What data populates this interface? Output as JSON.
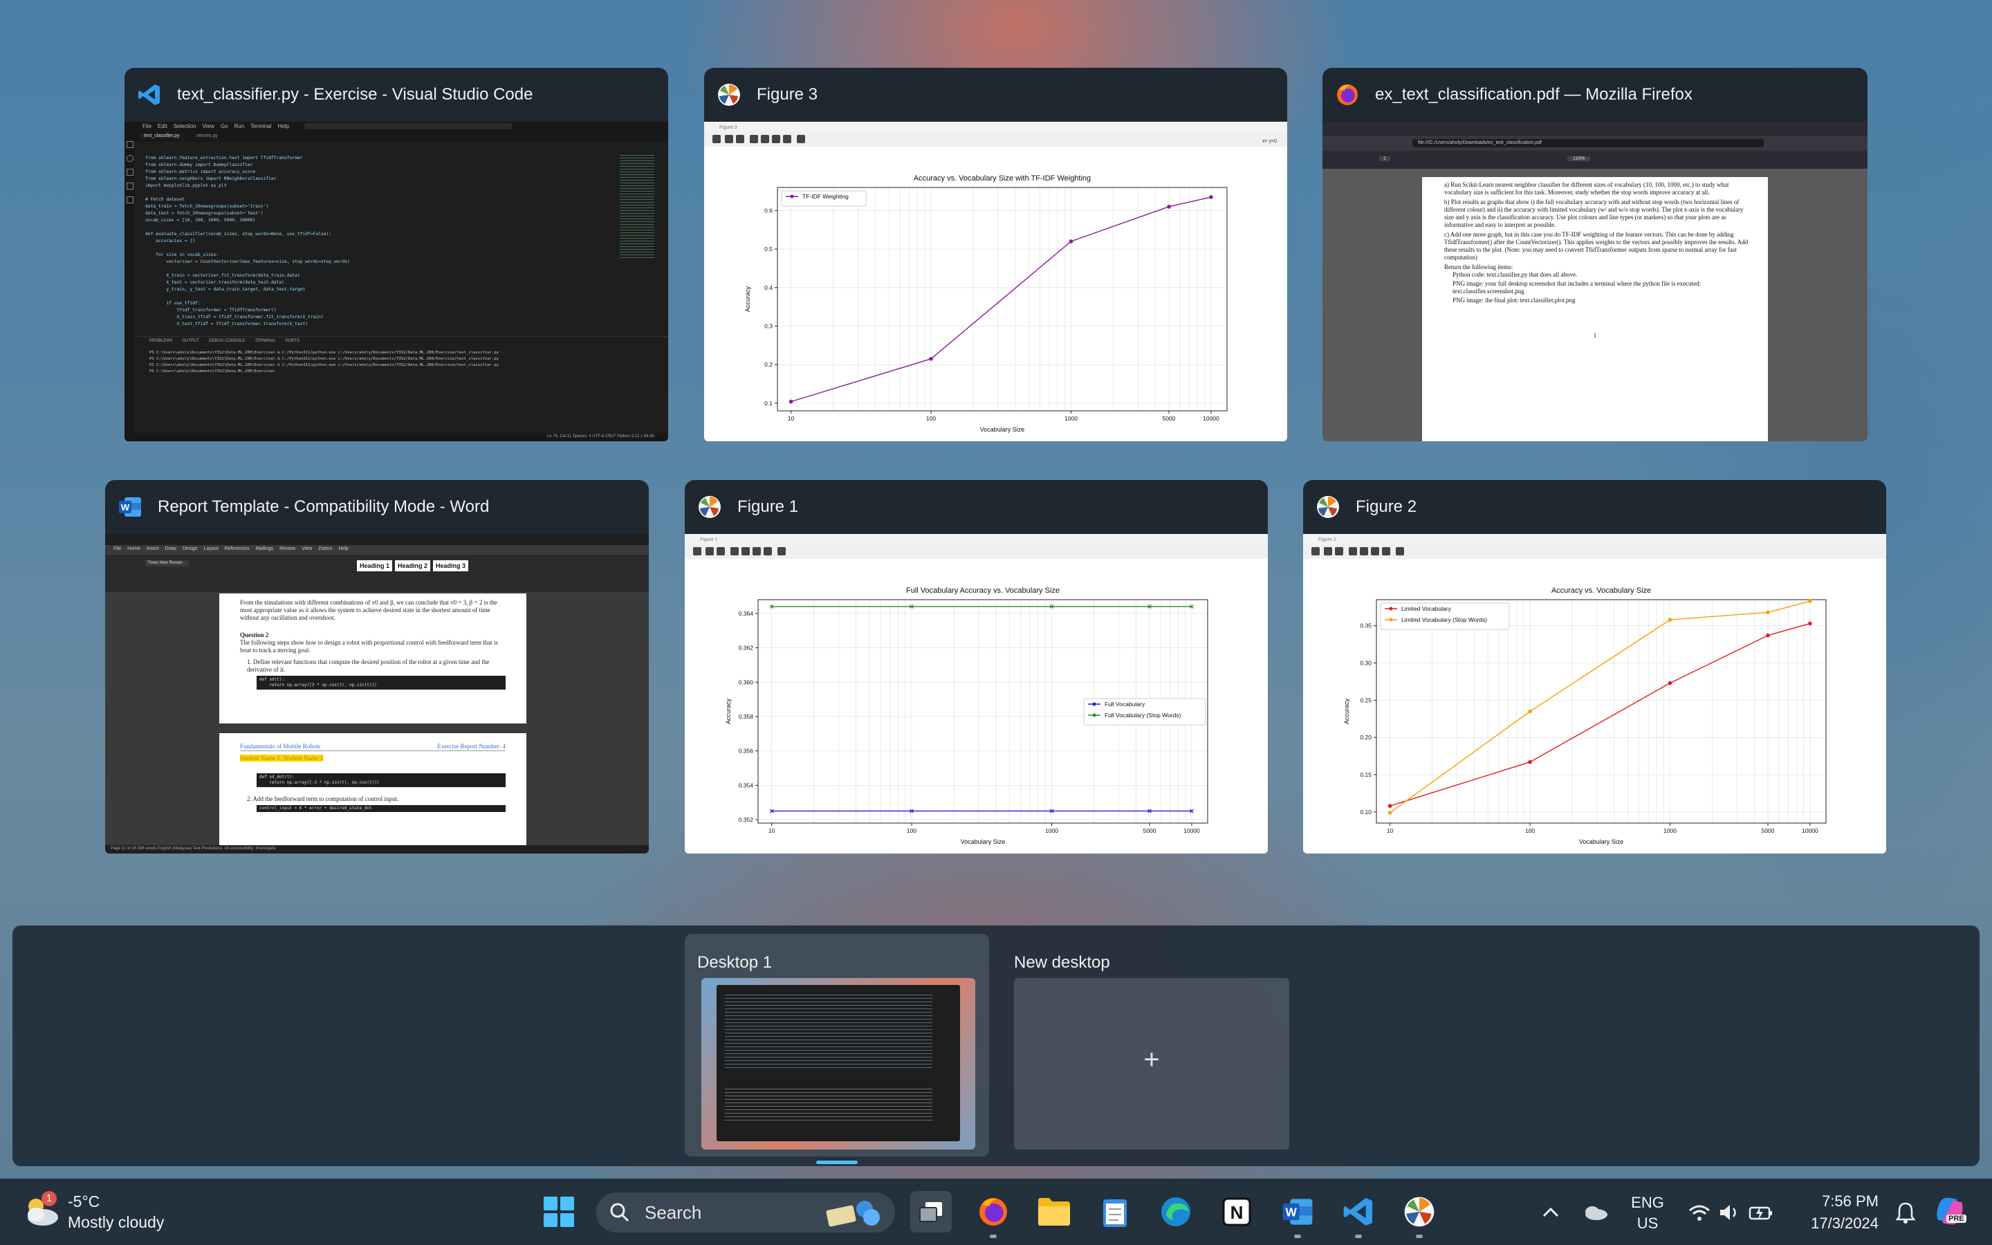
{
  "windows": {
    "vscode": {
      "title": "text_classifier.py - Exercise - Visual Studio Code",
      "menu": [
        "File",
        "Edit",
        "Selection",
        "View",
        "Go",
        "Run",
        "Terminal",
        "Help"
      ],
      "tab": "text_classifier.py",
      "tab2": "reinres.py",
      "code": [
        "from sklearn.feature_extraction.text import TfidfTransformer",
        "from sklearn.dummy import DummyClassifier",
        "from sklearn.metrics import accuracy_score",
        "from sklearn.neighbors import KNeighborsClassifier",
        "import matplotlib.pyplot as plt",
        "",
        "# Fetch dataset",
        "data_train = fetch_20newsgroups(subset='train')",
        "data_test = fetch_20newsgroups(subset='test')",
        "vocab_sizes = [10, 100, 1000, 5000, 10000]",
        "",
        "def evaluate_classifier(vocab_sizes, stop_words=None, use_tfidf=False):",
        "    accuracies = []",
        "",
        "    for size in vocab_sizes:",
        "        vectorizer = CountVectorizer(max_features=size, stop_words=stop_words)",
        "",
        "        X_train = vectorizer.fit_transform(data_train.data)",
        "        X_test = vectorizer.transform(data_test.data)",
        "        y_train, y_test = data_train.target, data_test.target",
        "",
        "        if use_tfidf:",
        "            tfidf_transformer = TfidfTransformer()",
        "            X_train_tfidf = tfidf_transformer.fit_transform(X_train)",
        "            X_test_tfidf = tfidf_transformer.transform(X_test)"
      ],
      "panel_tabs": [
        "PROBLEMS",
        "OUTPUT",
        "DEBUG CONSOLE",
        "TERMINAL",
        "PORTS"
      ],
      "terminal": [
        "PS C:\\Users\\aholy\\Documents\\Y3S2\\Data.ML.200\\Exercise> & C:/Python311/python.exe c:/Users/aholy/Documents/Y3S2/Data.ML.200/Exercise/text_classifier.py",
        "PS C:\\Users\\aholy\\Documents\\Y3S2\\Data.ML.200\\Exercise> & C:/Python311/python.exe c:/Users/aholy/Documents/Y3S2/Data.ML.200/Exercise/text_classifier.py",
        "PS C:\\Users\\aholy\\Documents\\Y3S2\\Data.ML.200\\Exercise> & C:/Python311/python.exe c:/Users/aholy/Documents/Y3S2/Data.ML.200/Exercise/text_classifier.py",
        "PS C:\\Users\\aholy\\Documents\\Y3S2\\Data.ML.200\\Exercise>"
      ],
      "status": "Ln 78, Col 11   Spaces: 4   UTF-8   CRLF   Python   3.12.1 64-bit"
    },
    "figure3": {
      "title": "Figure 3",
      "inner_title": "Figure 3",
      "coord": "x= y=0."
    },
    "firefox": {
      "title": "ex_text_classification.pdf — Mozilla Firefox",
      "url": "file:///C:/Users/aholy/Downloads/ex_text_classification.pdf",
      "page_number": "1",
      "zoom": "110%",
      "items": [
        "a) Run Scikit-Learn nearest neighbor classifier for different sizes of vocabulary (10, 100, 1000, etc.) to study what vocabulary size is sufficient for this task. Moreover, study whether the stop words improve accuracy at all.",
        "b) Plot results as graphs that show i) the full vocabulary accuracy with and without stop words (two horizontal lines of different colour) and ii) the accuracy with limited vocabulary (w/ and w/o stop words). The plot x-axis is the vocabulary size and y axis is the classification accuracy. Use plot colours and line types (or markers) so that your plots are as informative and easy to interpret as possible.",
        "c) Add one more graph, but in this case you do TF-IDF weighting of the feature vectors. This can be done by adding TfidfTransformer() after the CountVectorizer(). This applies weights to the vectors and possibly improves the results. Add these results to the plot. (Note: you may need to convert TfidTransformer outputs from sparse to normal array for fast computation)"
      ],
      "return_label": "Return the following items:",
      "bullets": [
        "Python code: text.classifier.py that does all above.",
        "PNG image: your full desktop screenshot that includes a terminal where the python file is executed: text.classifier.screenshot.png",
        "PNG image: the final plot: text.classifier.plot.png"
      ]
    },
    "word": {
      "title": "Report Template  -  Compatibility Mode - Word",
      "ribbon_tabs": [
        "File",
        "Home",
        "Insert",
        "Draw",
        "Design",
        "Layout",
        "References",
        "Mailings",
        "Review",
        "View",
        "Zotero",
        "Help"
      ],
      "styles": [
        "Heading 1",
        "Heading 2",
        "Heading 3"
      ],
      "font": "Times New Roman",
      "para1": "From the simulations with different combinations of v0 and β, we can conclude that v0 = 3, β = 2 is the most appropriate value as it allows the system to achieve desired state in the shortest amount of time without any oscillation and overshoot.",
      "q2_heading": "Question 2",
      "q2_text": "The following steps show how to design a robot with proportional control with feedforward term that is bout to track a moving goal.",
      "step1": "1.   Define relevant functions that compute the desired position of the robot at a given time and the derivative of it.",
      "code1": [
        "def xd(t):",
        "    return np.array([3 * np.cos(t), np.sin(t)])"
      ],
      "header_left": "Fundamentals of Mobile Robots",
      "header_right": "Exercise Report Number: 4",
      "student": "Student Name 1, Student Name 2",
      "code2": [
        "def xd_dot(t):",
        "    return np.array([-3 * np.sin(t), np.cos(t)])"
      ],
      "step2": "2.   Add the feedforward term to computation of control input.",
      "code3": "control_input = K * error + desired_state_dot",
      "status": "Page 11 of 16   336 words   English (Malaysia)   Text Predictions: On   Accessibility: Investigate"
    },
    "figure1": {
      "title": "Figure 1",
      "inner_title": "Figure 1"
    },
    "figure2": {
      "title": "Figure 2",
      "inner_title": "Figure 2"
    }
  },
  "chart_data": [
    {
      "id": "figure3",
      "type": "line",
      "title": "Accuracy vs. Vocabulary Size with TF-IDF Weighting",
      "xlabel": "Vocabulary Size",
      "ylabel": "Accuracy",
      "x_scale": "log",
      "x": [
        10,
        100,
        1000,
        5000,
        10000
      ],
      "xticks": [
        "10",
        "100",
        "1000",
        "5000",
        "10000"
      ],
      "ylim": [
        0.08,
        0.66
      ],
      "yticks": [
        "0.1",
        "0.2",
        "0.3",
        "0.4",
        "0.5",
        "0.6"
      ],
      "grid": true,
      "legend_position": "upper left",
      "series": [
        {
          "name": "TF-IDF Weighting",
          "color": "#8b1a9a",
          "values": [
            0.104,
            0.215,
            0.52,
            0.61,
            0.635
          ]
        }
      ]
    },
    {
      "id": "figure1",
      "type": "line",
      "title": "Full Vocabulary Accuracy vs. Vocabulary Size",
      "xlabel": "Vocabulary Size",
      "ylabel": "Accuracy",
      "x_scale": "log",
      "x": [
        10,
        100,
        1000,
        5000,
        10000
      ],
      "xticks": [
        "10",
        "100",
        "1000",
        "5000",
        "10000"
      ],
      "ylim": [
        0.3518,
        0.3648
      ],
      "yticks": [
        "0.352",
        "0.354",
        "0.356",
        "0.358",
        "0.360",
        "0.362",
        "0.364"
      ],
      "grid": true,
      "legend_position": "center right",
      "series": [
        {
          "name": "Full Vocabulary",
          "color": "#1f1fd6",
          "values": [
            0.3525,
            0.3525,
            0.3525,
            0.3525,
            0.3525
          ]
        },
        {
          "name": "Full Vocabulary (Stop Words)",
          "color": "#2a8a2a",
          "values": [
            0.3644,
            0.3644,
            0.3644,
            0.3644,
            0.3644
          ]
        }
      ]
    },
    {
      "id": "figure2",
      "type": "line",
      "title": "Accuracy vs. Vocabulary Size",
      "xlabel": "Vocabulary Size",
      "ylabel": "Accuracy",
      "x_scale": "log",
      "x": [
        10,
        100,
        1000,
        5000,
        10000
      ],
      "xticks": [
        "10",
        "100",
        "1000",
        "5000",
        "10000"
      ],
      "ylim": [
        0.085,
        0.385
      ],
      "yticks": [
        "0.10",
        "0.15",
        "0.20",
        "0.25",
        "0.30",
        "0.35"
      ],
      "grid": true,
      "legend_position": "upper left",
      "series": [
        {
          "name": "Limited Vocabulary",
          "color": "#e8191b",
          "values": [
            0.108,
            0.167,
            0.273,
            0.337,
            0.353
          ]
        },
        {
          "name": "Limited Vocabulary (Stop Words)",
          "color": "#f5a300",
          "values": [
            0.099,
            0.235,
            0.358,
            0.368,
            0.383
          ]
        }
      ]
    }
  ],
  "desktops": {
    "desktop1_label": "Desktop 1",
    "new_label": "New desktop",
    "plus": "+"
  },
  "taskbar": {
    "weather_badge": "1",
    "temperature": "-5°C",
    "condition": "Mostly cloudy",
    "search_placeholder": "Search",
    "lang1": "ENG",
    "lang2": "US",
    "time": "7:56 PM",
    "date": "17/3/2024",
    "copilot_badge": "PRE"
  }
}
